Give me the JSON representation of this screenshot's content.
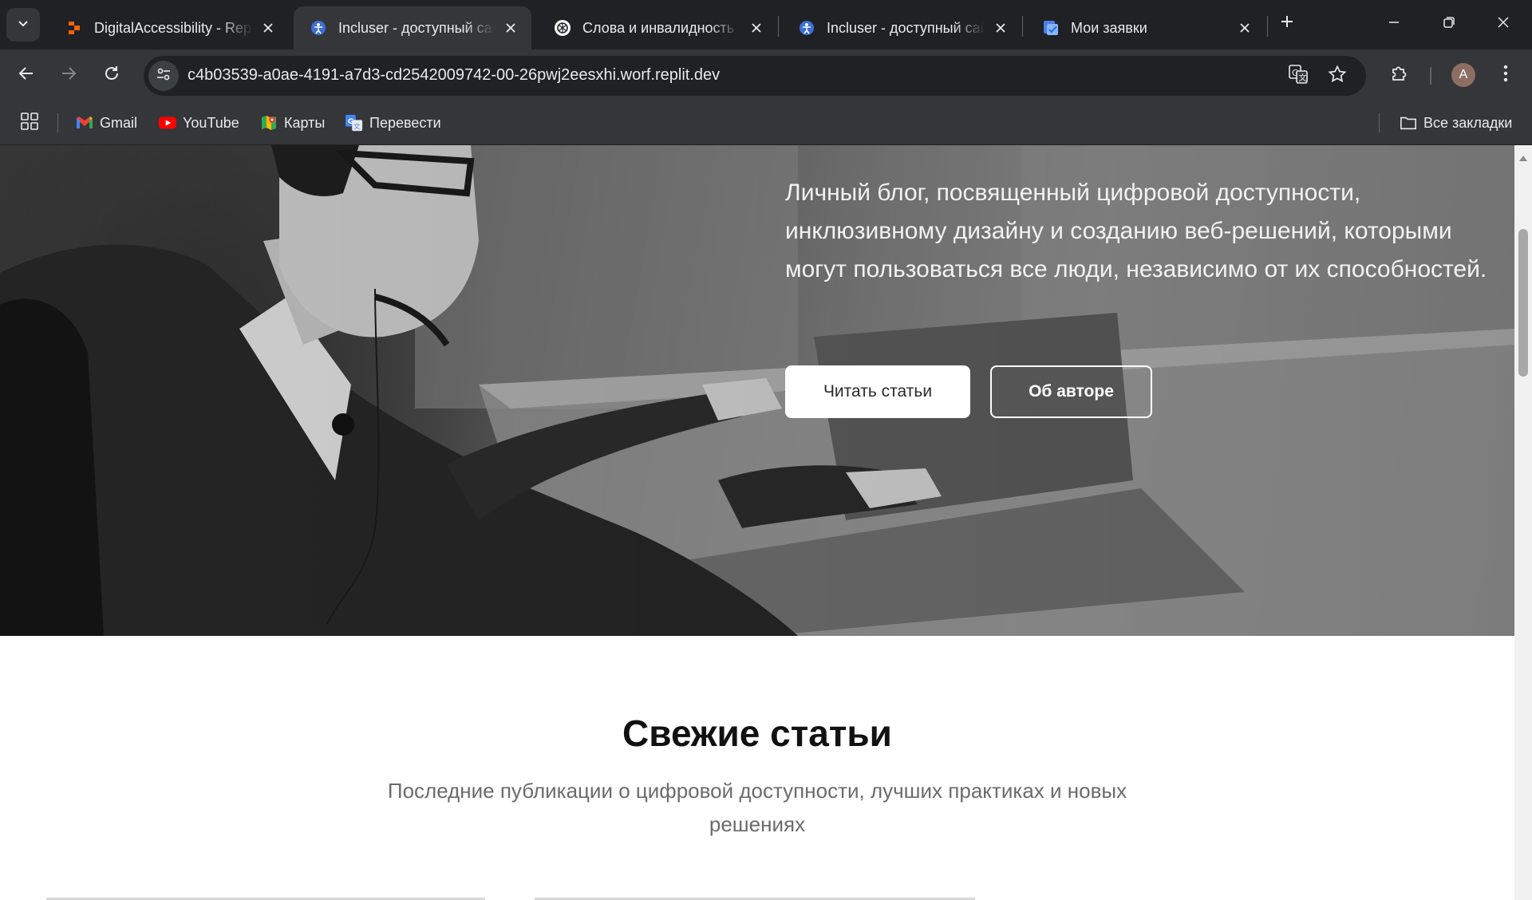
{
  "browser": {
    "tabs": [
      {
        "title": "DigitalAccessibility - Replit",
        "favicon": "replit-icon",
        "active": false
      },
      {
        "title": "Incluser - доступный сайт",
        "favicon": "incluser-icon",
        "active": true
      },
      {
        "title": "Слова и инвалидность",
        "favicon": "chatgpt-icon",
        "active": false
      },
      {
        "title": "Incluser - доступный сайт",
        "favicon": "incluser-icon",
        "active": false
      },
      {
        "title": "Мои заявки",
        "favicon": "tasks-icon",
        "active": false
      }
    ],
    "address": "c4b03539-a0ae-4191-a7d3-cd2542009742-00-26pwj2eesxhi.worf.replit.dev",
    "profile_initial": "A",
    "bookmarks": [
      {
        "label": "Gmail",
        "icon": "gmail-icon"
      },
      {
        "label": "YouTube",
        "icon": "youtube-icon"
      },
      {
        "label": "Карты",
        "icon": "maps-icon"
      },
      {
        "label": "Перевести",
        "icon": "translate-icon"
      }
    ],
    "all_bookmarks": "Все закладки"
  },
  "hero": {
    "description": "Личный блог, посвященный цифровой доступности, инклюзивному дизайну и созданию веб-решений, которыми могут пользоваться все люди, независимо от их способностей.",
    "primary_button": "Читать статьи",
    "secondary_button": "Об авторе"
  },
  "articles": {
    "title": "Свежие статьи",
    "subtitle": "Последние публикации о цифровой доступности, лучших практиках и новых решениях"
  }
}
